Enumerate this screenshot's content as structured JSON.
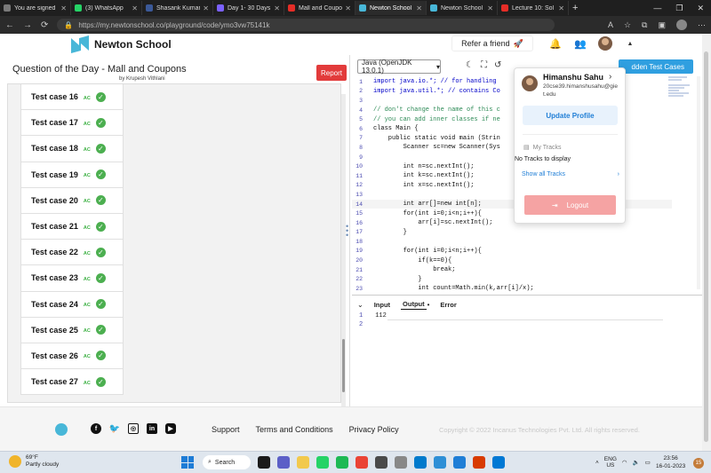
{
  "browser": {
    "tabs": [
      {
        "label": "You are signed",
        "color": "#7a7a7a"
      },
      {
        "label": "(3) WhatsApp",
        "color": "#25d366"
      },
      {
        "label": "Shasank Kumar",
        "color": "#3b5998"
      },
      {
        "label": "Day 1- 30 Days",
        "color": "#7b61ff"
      },
      {
        "label": "Mall and Coupo",
        "color": "#e52d27"
      },
      {
        "label": "Newton School",
        "color": "#48b7d8"
      },
      {
        "label": "Newton School",
        "color": "#48b7d8"
      },
      {
        "label": "Lecture 10: Sol",
        "color": "#e52d27"
      }
    ],
    "url": "https://my.newtonschool.co/playground/code/ymo3vw75141k",
    "new_tab": "+",
    "win_controls": [
      "—",
      "❐",
      "✕"
    ]
  },
  "header": {
    "brand": "Newton School",
    "refer": "Refer a friend",
    "refer_emoji": "🚀"
  },
  "question": {
    "title": "Question of the Day - Mall and Coupons",
    "author": "by Krupesh Vithlani",
    "report": "Report"
  },
  "test_cases": [
    {
      "name": "Test case 16",
      "status": "AC"
    },
    {
      "name": "Test case 17",
      "status": "AC"
    },
    {
      "name": "Test case 18",
      "status": "AC"
    },
    {
      "name": "Test case 19",
      "status": "AC"
    },
    {
      "name": "Test case 20",
      "status": "AC"
    },
    {
      "name": "Test case 21",
      "status": "AC"
    },
    {
      "name": "Test case 22",
      "status": "AC"
    },
    {
      "name": "Test case 23",
      "status": "AC"
    },
    {
      "name": "Test case 24",
      "status": "AC"
    },
    {
      "name": "Test case 25",
      "status": "AC"
    },
    {
      "name": "Test case 26",
      "status": "AC"
    },
    {
      "name": "Test case 27",
      "status": "AC"
    }
  ],
  "editor": {
    "language": "Java (OpenJDK 13.0.1)",
    "hidden_tc": "dden Test Cases",
    "highlight_line": 14,
    "lines": [
      {
        "n": "1",
        "t": "import java.io.*; // for handling",
        "c": "kw"
      },
      {
        "n": "2",
        "t": "import java.util.*; // contains Co",
        "c": "kw"
      },
      {
        "n": "3",
        "t": "",
        "c": ""
      },
      {
        "n": "4",
        "t": "// don't change the name of this c",
        "c": "comment"
      },
      {
        "n": "5",
        "t": "// you can add inner classes if ne",
        "c": "comment"
      },
      {
        "n": "6",
        "t": "class Main {",
        "c": ""
      },
      {
        "n": "7",
        "t": "    public static void main (Strin",
        "c": ""
      },
      {
        "n": "8",
        "t": "        Scanner sc=new Scanner(Sys",
        "c": ""
      },
      {
        "n": "9",
        "t": "",
        "c": ""
      },
      {
        "n": "10",
        "t": "        int n=sc.nextInt();",
        "c": ""
      },
      {
        "n": "11",
        "t": "        int k=sc.nextInt();",
        "c": ""
      },
      {
        "n": "12",
        "t": "        int x=sc.nextInt();",
        "c": ""
      },
      {
        "n": "13",
        "t": "",
        "c": ""
      },
      {
        "n": "14",
        "t": "        int arr[]=new int[n];",
        "c": ""
      },
      {
        "n": "15",
        "t": "        for(int i=0;i<n;i++){",
        "c": ""
      },
      {
        "n": "16",
        "t": "            arr[i]=sc.nextInt();",
        "c": ""
      },
      {
        "n": "17",
        "t": "        }",
        "c": ""
      },
      {
        "n": "18",
        "t": "",
        "c": ""
      },
      {
        "n": "19",
        "t": "        for(int i=0;i<n;i++){",
        "c": ""
      },
      {
        "n": "20",
        "t": "            if(k==0){",
        "c": ""
      },
      {
        "n": "21",
        "t": "                break;",
        "c": ""
      },
      {
        "n": "22",
        "t": "            }",
        "c": ""
      },
      {
        "n": "23",
        "t": "            int count=Math.min(k,arr[i]/x);",
        "c": ""
      }
    ]
  },
  "profile": {
    "name": "Himanshu Sahu",
    "email": "20cse39.himanshusahu@giet.edu",
    "update": "Update Profile",
    "my_tracks": "My Tracks",
    "no_tracks": "No Tracks to display",
    "show_all": "Show all Tracks",
    "logout": "Logout"
  },
  "io": {
    "tabs": [
      "Input",
      "Output",
      "Error"
    ],
    "active_tab": "Output",
    "output_lines": [
      {
        "n": "1",
        "t": "112"
      },
      {
        "n": "2",
        "t": ""
      }
    ]
  },
  "footer": {
    "links": [
      "Support",
      "Terms and Conditions",
      "Privacy Policy"
    ],
    "copyright": "Copyright © 2022 Incanus Technologies Pvt. Ltd. All rights reserved.",
    "social": [
      "facebook-icon",
      "twitter-icon",
      "instagram-icon",
      "linkedin-icon",
      "youtube-icon"
    ]
  },
  "taskbar": {
    "temp": "69°F",
    "weather": "Partly cloudy",
    "search": "Search",
    "lang_line1": "ENG",
    "lang_line2": "US",
    "time": "23:56",
    "date": "16-01-2023",
    "notifications": "15",
    "apps": [
      "#1a1a1a",
      "#5b5fc7",
      "#f2c94c",
      "#25d366",
      "#1db954",
      "#ea4335",
      "#4a4a4a",
      "#888888",
      "#007acc",
      "#2e8fd6",
      "#1f7ed6",
      "#d83b01",
      "#0078d4"
    ]
  }
}
